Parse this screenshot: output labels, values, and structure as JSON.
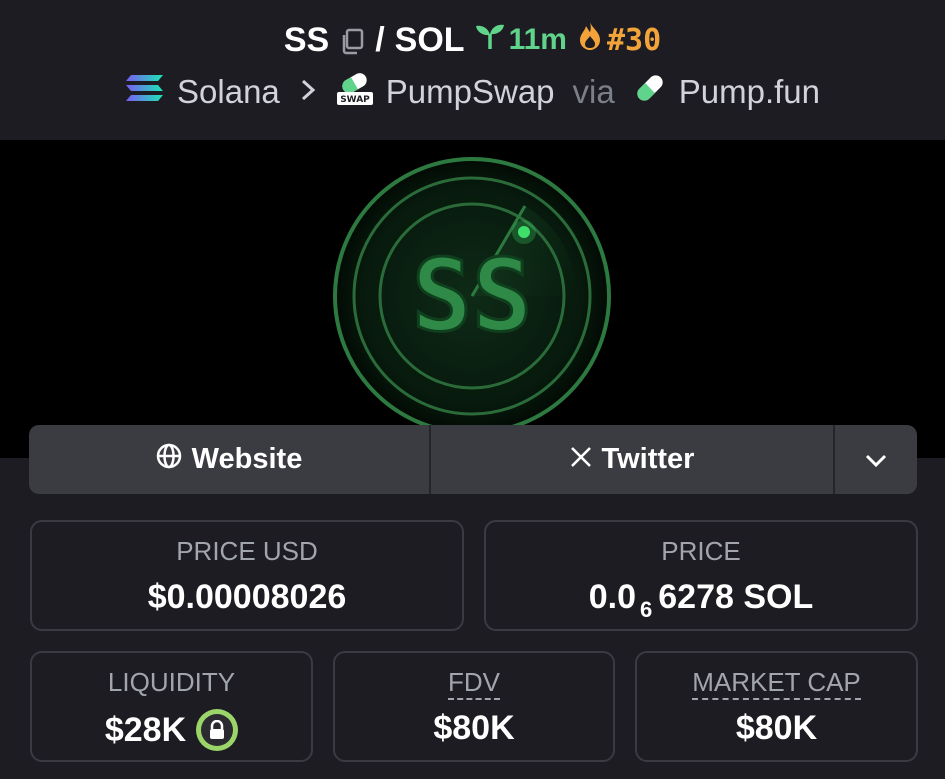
{
  "header": {
    "symbol": "SS",
    "separator": "/",
    "quote": "SOL",
    "age": "11m",
    "rank": "#30",
    "breadcrumb": {
      "chain": "Solana",
      "dex": "PumpSwap",
      "via": "via",
      "launchpad": "Pump.fun"
    }
  },
  "banner": {
    "logo_text": "SS"
  },
  "links": {
    "website": "Website",
    "twitter": "Twitter"
  },
  "stats": {
    "price_usd": {
      "label": "PRICE USD",
      "value": "$0.00008026"
    },
    "price": {
      "label": "PRICE",
      "value_prefix": "0.0",
      "zeros": "6",
      "value_suffix": "6278 SOL"
    },
    "liquidity": {
      "label": "LIQUIDITY",
      "value": "$28K"
    },
    "fdv": {
      "label": "FDV",
      "value": "$80K"
    },
    "market_cap": {
      "label": "MARKET CAP",
      "value": "$80K"
    }
  },
  "colors": {
    "background": "#1c1c22",
    "age_green": "#5fd48a",
    "rank_orange": "#f2a33a",
    "lock_green": "#9bd56a",
    "logo_green": "#2e8a46"
  },
  "icons": [
    "copy-icon",
    "seedling-icon",
    "flame-icon",
    "solana-icon",
    "chevron-right-icon",
    "pumpswap-icon",
    "pill-icon",
    "globe-icon",
    "x-logo-icon",
    "chevron-down-icon",
    "lock-icon"
  ]
}
